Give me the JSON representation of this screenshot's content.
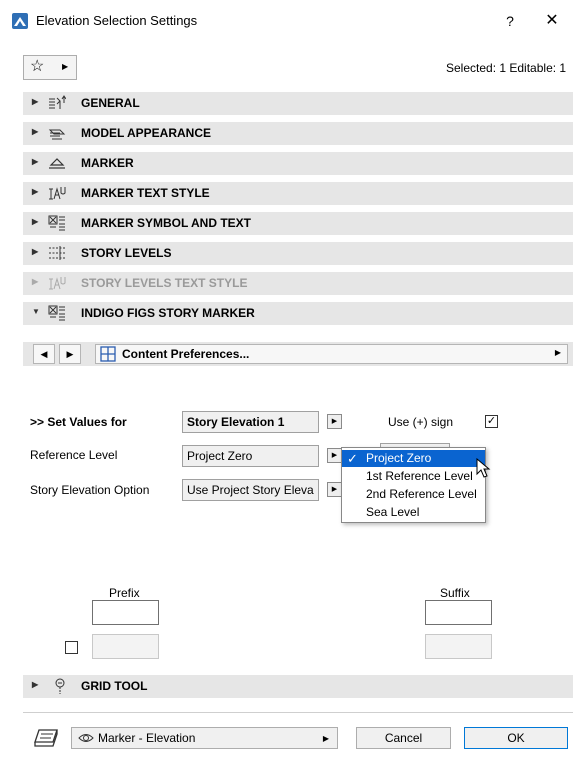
{
  "window": {
    "title": "Elevation Selection Settings",
    "help_label": "?",
    "close_label": "✕"
  },
  "header": {
    "selected_info": "Selected: 1 Editable: 1",
    "favorites_icon": "star-icon"
  },
  "panels": [
    {
      "label": "GENERAL",
      "icon": "general-icon",
      "expanded": false
    },
    {
      "label": "MODEL APPEARANCE",
      "icon": "model-appearance-icon",
      "expanded": false
    },
    {
      "label": "MARKER",
      "icon": "marker-icon",
      "expanded": false
    },
    {
      "label": "MARKER TEXT STYLE",
      "icon": "text-style-icon",
      "expanded": false
    },
    {
      "label": "MARKER SYMBOL AND TEXT",
      "icon": "symbol-text-icon",
      "expanded": false
    },
    {
      "label": "STORY LEVELS",
      "icon": "story-levels-icon",
      "expanded": false
    },
    {
      "label": "STORY LEVELS TEXT STYLE",
      "icon": "text-style-icon",
      "expanded": false,
      "disabled": true
    },
    {
      "label": "INDIGO FIGS STORY MARKER",
      "icon": "symbol-text-icon",
      "expanded": true
    }
  ],
  "content_prefs": {
    "prev_icon": "prev-arrow-icon",
    "next_icon": "next-arrow-icon",
    "label": "Content Preferences..."
  },
  "form": {
    "set_values_label": ">> Set Values for",
    "set_values_value": "Story Elevation 1",
    "use_plus_label": "Use (+) sign",
    "use_plus_checked": true,
    "reference_level_label": "Reference Level",
    "reference_level_value": "Project Zero",
    "story_elev_label": "Story Elevation Option",
    "story_elev_value": "Use Project Story Eleva",
    "prefix_label": "Prefix",
    "suffix_label": "Suffix",
    "prefix_value": "",
    "suffix_value": "",
    "extra_checked": false
  },
  "dropdown": {
    "options": [
      "Project Zero",
      "1st Reference Level",
      "2nd Reference Level",
      "Sea Level"
    ],
    "selected": "Project Zero",
    "selected_color": "#0a64d0"
  },
  "grid_tool": {
    "label": "GRID TOOL",
    "icon": "grid-tool-icon"
  },
  "footer": {
    "layout_icon": "view-layout-icon",
    "view_label": "Marker - Elevation",
    "cancel_label": "Cancel",
    "ok_label": "OK"
  }
}
